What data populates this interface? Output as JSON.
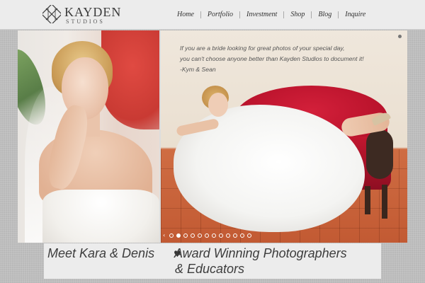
{
  "brand": {
    "name": "KAYDEN",
    "sub": "STUDIOS"
  },
  "nav": {
    "items": [
      {
        "label": "Home"
      },
      {
        "label": "Portfolio"
      },
      {
        "label": "Investment"
      },
      {
        "label": "Shop"
      },
      {
        "label": "Blog"
      },
      {
        "label": "Inquire"
      }
    ]
  },
  "slider": {
    "quote_lines": [
      "If you are a bride looking for great photos of your special day,",
      "you can't choose anyone better than Kayden Studios to document it!",
      "-Kym & Sean"
    ],
    "dot_count": 12,
    "active_dot": 1
  },
  "tagline": {
    "left": "Meet Kara & Denis",
    "heart": "♥",
    "right_line1": "Award Winning Photographers",
    "right_line2": "& Educators"
  }
}
